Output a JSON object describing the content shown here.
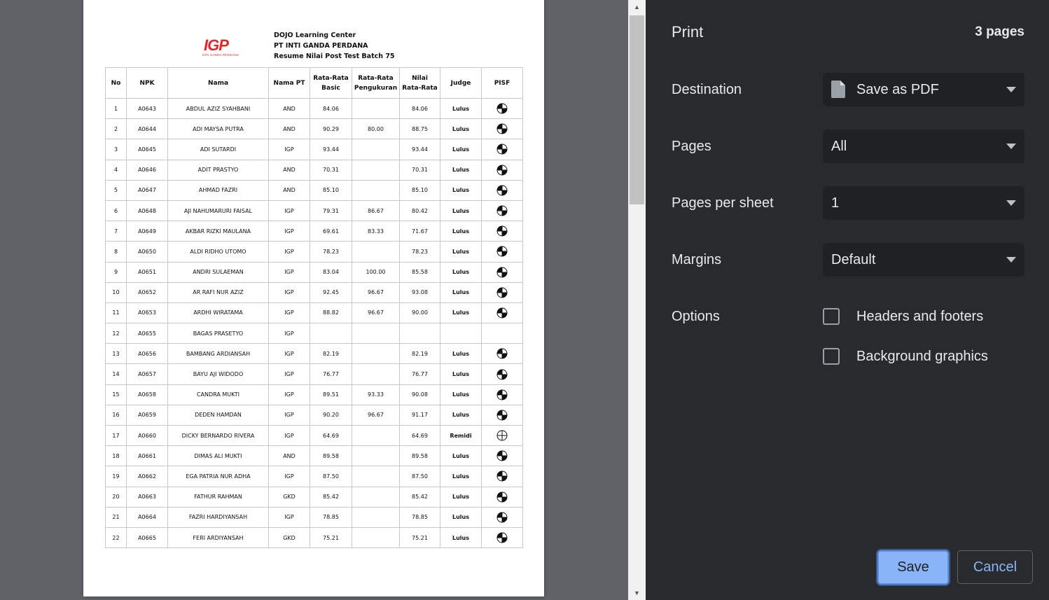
{
  "document": {
    "logo_text": "IGP",
    "logo_subtext": "INTI GANDA PERDANA",
    "header_lines": [
      "DOJO Learning Center",
      "PT INTI GANDA PERDANA",
      "Resume Nilai Post Test Batch 75"
    ],
    "columns": [
      "No",
      "NPK",
      "Nama",
      "Nama PT",
      "Rata-Rata Basic",
      "Rata-Rata Pengukuran",
      "Nilai Rata-Rata",
      "Judge",
      "PISF"
    ],
    "rows": [
      {
        "no": "1",
        "npk": "A0643",
        "nama": "ABDUL AZIZ SYAHBANI",
        "pt": "AND",
        "basic": "84.06",
        "pengukuran": "",
        "rata": "84.06",
        "judge": "Lulus",
        "pisf": 2
      },
      {
        "no": "2",
        "npk": "A0644",
        "nama": "ADI MAYSA PUTRA",
        "pt": "AND",
        "basic": "90.29",
        "pengukuran": "80.00",
        "rata": "88.75",
        "judge": "Lulus",
        "pisf": 2
      },
      {
        "no": "3",
        "npk": "A0645",
        "nama": "ADI SUTARDI",
        "pt": "IGP",
        "basic": "93.44",
        "pengukuran": "",
        "rata": "93.44",
        "judge": "Lulus",
        "pisf": 2
      },
      {
        "no": "4",
        "npk": "A0646",
        "nama": "ADIT PRASTYO",
        "pt": "AND",
        "basic": "70.31",
        "pengukuran": "",
        "rata": "70.31",
        "judge": "Lulus",
        "pisf": 2
      },
      {
        "no": "5",
        "npk": "A0647",
        "nama": "AHMAD FAZRI",
        "pt": "AND",
        "basic": "85.10",
        "pengukuran": "",
        "rata": "85.10",
        "judge": "Lulus",
        "pisf": 2
      },
      {
        "no": "6",
        "npk": "A0648",
        "nama": "AJI NAHUMARURI FAISAL",
        "pt": "IGP",
        "basic": "79.31",
        "pengukuran": "86.67",
        "rata": "80.42",
        "judge": "Lulus",
        "pisf": 2
      },
      {
        "no": "7",
        "npk": "A0649",
        "nama": "AKBAR RIZKI MAULANA",
        "pt": "IGP",
        "basic": "69.61",
        "pengukuran": "83.33",
        "rata": "71.67",
        "judge": "Lulus",
        "pisf": 2
      },
      {
        "no": "8",
        "npk": "A0650",
        "nama": "ALDI RIDHO UTOMO",
        "pt": "IGP",
        "basic": "78.23",
        "pengukuran": "",
        "rata": "78.23",
        "judge": "Lulus",
        "pisf": 2
      },
      {
        "no": "9",
        "npk": "A0651",
        "nama": "ANDRI SULAEMAN",
        "pt": "IGP",
        "basic": "83.04",
        "pengukuran": "100.00",
        "rata": "85.58",
        "judge": "Lulus",
        "pisf": 2
      },
      {
        "no": "10",
        "npk": "A0652",
        "nama": "AR RAFI NUR AZIZ",
        "pt": "IGP",
        "basic": "92.45",
        "pengukuran": "96.67",
        "rata": "93.08",
        "judge": "Lulus",
        "pisf": 2
      },
      {
        "no": "11",
        "npk": "A0653",
        "nama": "ARDHI WIRATAMA",
        "pt": "IGP",
        "basic": "88.82",
        "pengukuran": "96.67",
        "rata": "90.00",
        "judge": "Lulus",
        "pisf": 2
      },
      {
        "no": "12",
        "npk": "A0655",
        "nama": "BAGAS PRASETYO",
        "pt": "IGP",
        "basic": "",
        "pengukuran": "",
        "rata": "",
        "judge": "",
        "pisf": -1
      },
      {
        "no": "13",
        "npk": "A0656",
        "nama": "BAMBANG ARDIANSAH",
        "pt": "IGP",
        "basic": "82.19",
        "pengukuran": "",
        "rata": "82.19",
        "judge": "Lulus",
        "pisf": 2
      },
      {
        "no": "14",
        "npk": "A0657",
        "nama": "BAYU AJI WIDODO",
        "pt": "IGP",
        "basic": "76.77",
        "pengukuran": "",
        "rata": "76.77",
        "judge": "Lulus",
        "pisf": 2
      },
      {
        "no": "15",
        "npk": "A0658",
        "nama": "CANDRA MUKTI",
        "pt": "IGP",
        "basic": "89.51",
        "pengukuran": "93.33",
        "rata": "90.08",
        "judge": "Lulus",
        "pisf": 2
      },
      {
        "no": "16",
        "npk": "A0659",
        "nama": "DEDEN HAMDAN",
        "pt": "IGP",
        "basic": "90.20",
        "pengukuran": "96.67",
        "rata": "91.17",
        "judge": "Lulus",
        "pisf": 2
      },
      {
        "no": "17",
        "npk": "A0660",
        "nama": "DICKY BERNARDO RIVERA",
        "pt": "IGP",
        "basic": "64.69",
        "pengukuran": "",
        "rata": "64.69",
        "judge": "Remidi",
        "pisf": 0
      },
      {
        "no": "18",
        "npk": "A0661",
        "nama": "DIMAS ALI MUKTI",
        "pt": "AND",
        "basic": "89.58",
        "pengukuran": "",
        "rata": "89.58",
        "judge": "Lulus",
        "pisf": 2
      },
      {
        "no": "19",
        "npk": "A0662",
        "nama": "EGA PATRIA NUR ADHA",
        "pt": "IGP",
        "basic": "87.50",
        "pengukuran": "",
        "rata": "87.50",
        "judge": "Lulus",
        "pisf": 2
      },
      {
        "no": "20",
        "npk": "A0663",
        "nama": "FATHUR RAHMAN",
        "pt": "GKD",
        "basic": "85.42",
        "pengukuran": "",
        "rata": "85.42",
        "judge": "Lulus",
        "pisf": 2
      },
      {
        "no": "21",
        "npk": "A0664",
        "nama": "FAZRI HARDIYANSAH",
        "pt": "IGP",
        "basic": "78.85",
        "pengukuran": "",
        "rata": "78.85",
        "judge": "Lulus",
        "pisf": 2
      },
      {
        "no": "22",
        "npk": "A0665",
        "nama": "FERI ARDIYANSAH",
        "pt": "GKD",
        "basic": "75.21",
        "pengukuran": "",
        "rata": "75.21",
        "judge": "Lulus",
        "pisf": 2
      }
    ]
  },
  "print_panel": {
    "title": "Print",
    "page_count": "3 pages",
    "destination": {
      "label": "Destination",
      "value": "Save as PDF",
      "icon": "file-icon"
    },
    "pages": {
      "label": "Pages",
      "value": "All"
    },
    "pages_per_sheet": {
      "label": "Pages per sheet",
      "value": "1"
    },
    "margins": {
      "label": "Margins",
      "value": "Default"
    },
    "options": {
      "label": "Options",
      "headers_footers": {
        "label": "Headers and footers",
        "checked": false
      },
      "background_graphics": {
        "label": "Background graphics",
        "checked": false
      }
    },
    "save_label": "Save",
    "cancel_label": "Cancel"
  },
  "colors": {
    "accent": "#8ab4f8",
    "panel_bg": "#292a2d",
    "field_bg": "#202124",
    "logo_red": "#e3262a"
  }
}
